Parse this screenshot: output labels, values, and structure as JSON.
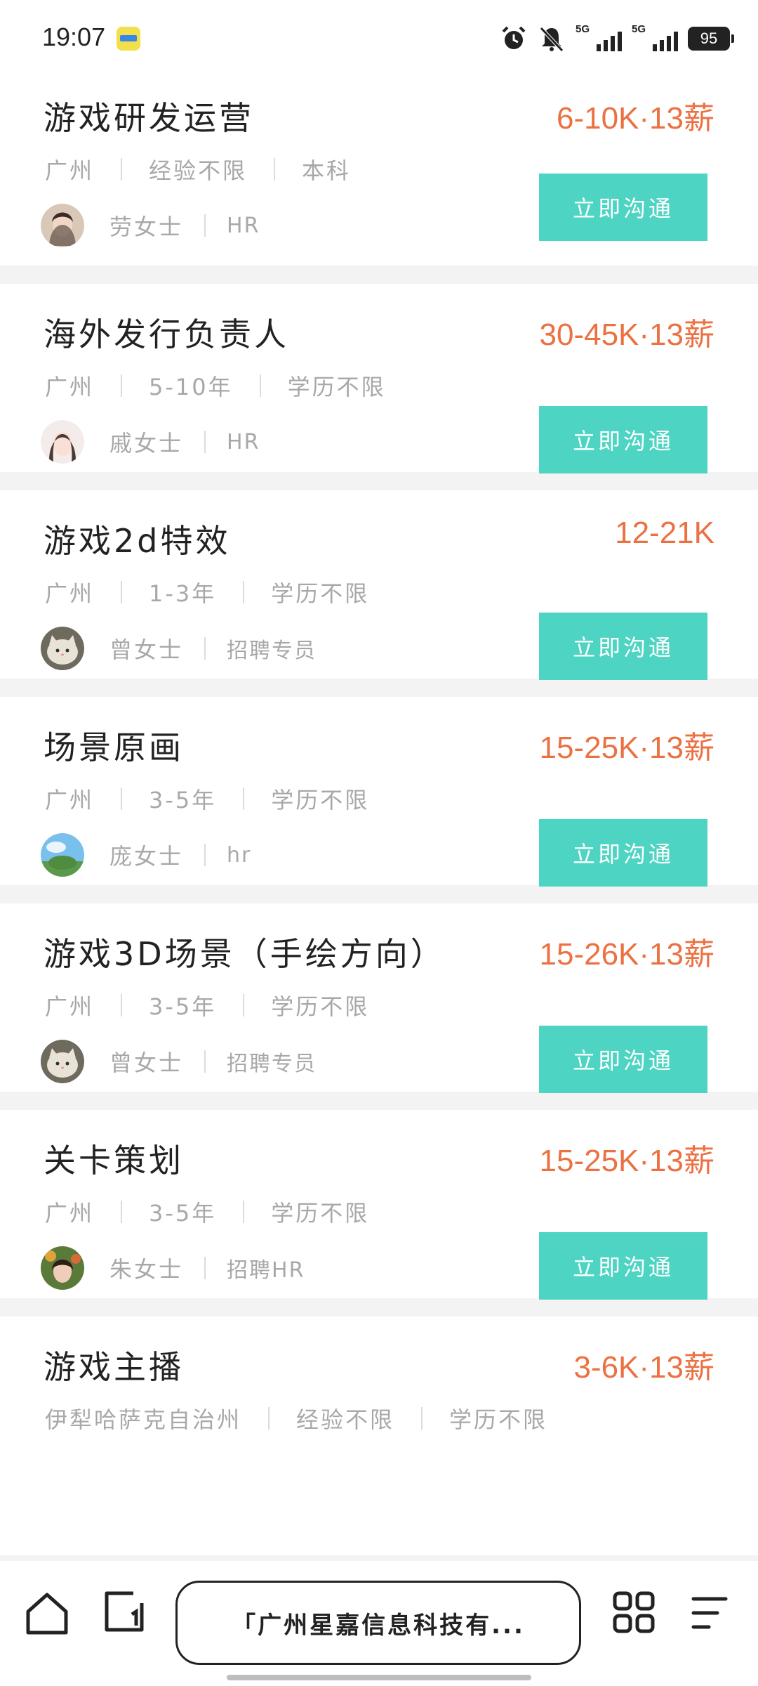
{
  "status_bar": {
    "time": "19:07",
    "signal1_label": "5G",
    "signal2_label": "5G",
    "battery": "95",
    "icons": [
      "app-notification-icon",
      "alarm-icon",
      "bell-muted-icon",
      "signal-icon",
      "signal-icon",
      "battery-icon"
    ]
  },
  "jobs": [
    {
      "title": "游戏研发运营",
      "salary": "6-10K·13薪",
      "location": "广州",
      "experience": "经验不限",
      "education": "本科",
      "recruiter_name": "劳女士",
      "recruiter_role": "HR",
      "button": "立即沟通"
    },
    {
      "title": "海外发行负责人",
      "salary": "30-45K·13薪",
      "location": "广州",
      "experience": "5-10年",
      "education": "学历不限",
      "recruiter_name": "戚女士",
      "recruiter_role": "HR",
      "button": "立即沟通"
    },
    {
      "title": "游戏2d特效",
      "salary": "12-21K",
      "location": "广州",
      "experience": "1-3年",
      "education": "学历不限",
      "recruiter_name": "曾女士",
      "recruiter_role": "招聘专员",
      "button": "立即沟通"
    },
    {
      "title": "场景原画",
      "salary": "15-25K·13薪",
      "location": "广州",
      "experience": "3-5年",
      "education": "学历不限",
      "recruiter_name": "庞女士",
      "recruiter_role": "hr",
      "button": "立即沟通"
    },
    {
      "title": "游戏3D场景（手绘方向）",
      "salary": "15-26K·13薪",
      "location": "广州",
      "experience": "3-5年",
      "education": "学历不限",
      "recruiter_name": "曾女士",
      "recruiter_role": "招聘专员",
      "button": "立即沟通"
    },
    {
      "title": "关卡策划",
      "salary": "15-25K·13薪",
      "location": "广州",
      "experience": "3-5年",
      "education": "学历不限",
      "recruiter_name": "朱女士",
      "recruiter_role": "招聘HR",
      "button": "立即沟通"
    },
    {
      "title": "游戏主播",
      "salary": "3-6K·13薪",
      "location": "伊犁哈萨克自治州",
      "experience": "经验不限",
      "education": "学历不限"
    }
  ],
  "bottom_nav": {
    "page_title": "「广州星嘉信息科技有...",
    "icons": [
      "home-icon",
      "tabs-icon",
      "apps-grid-icon",
      "menu-icon"
    ]
  },
  "colors": {
    "salary": "#ec7142",
    "button": "#4dd4c2",
    "meta_text": "#a8a8a8",
    "title_text": "#222222",
    "background": "#f3f3f3"
  }
}
